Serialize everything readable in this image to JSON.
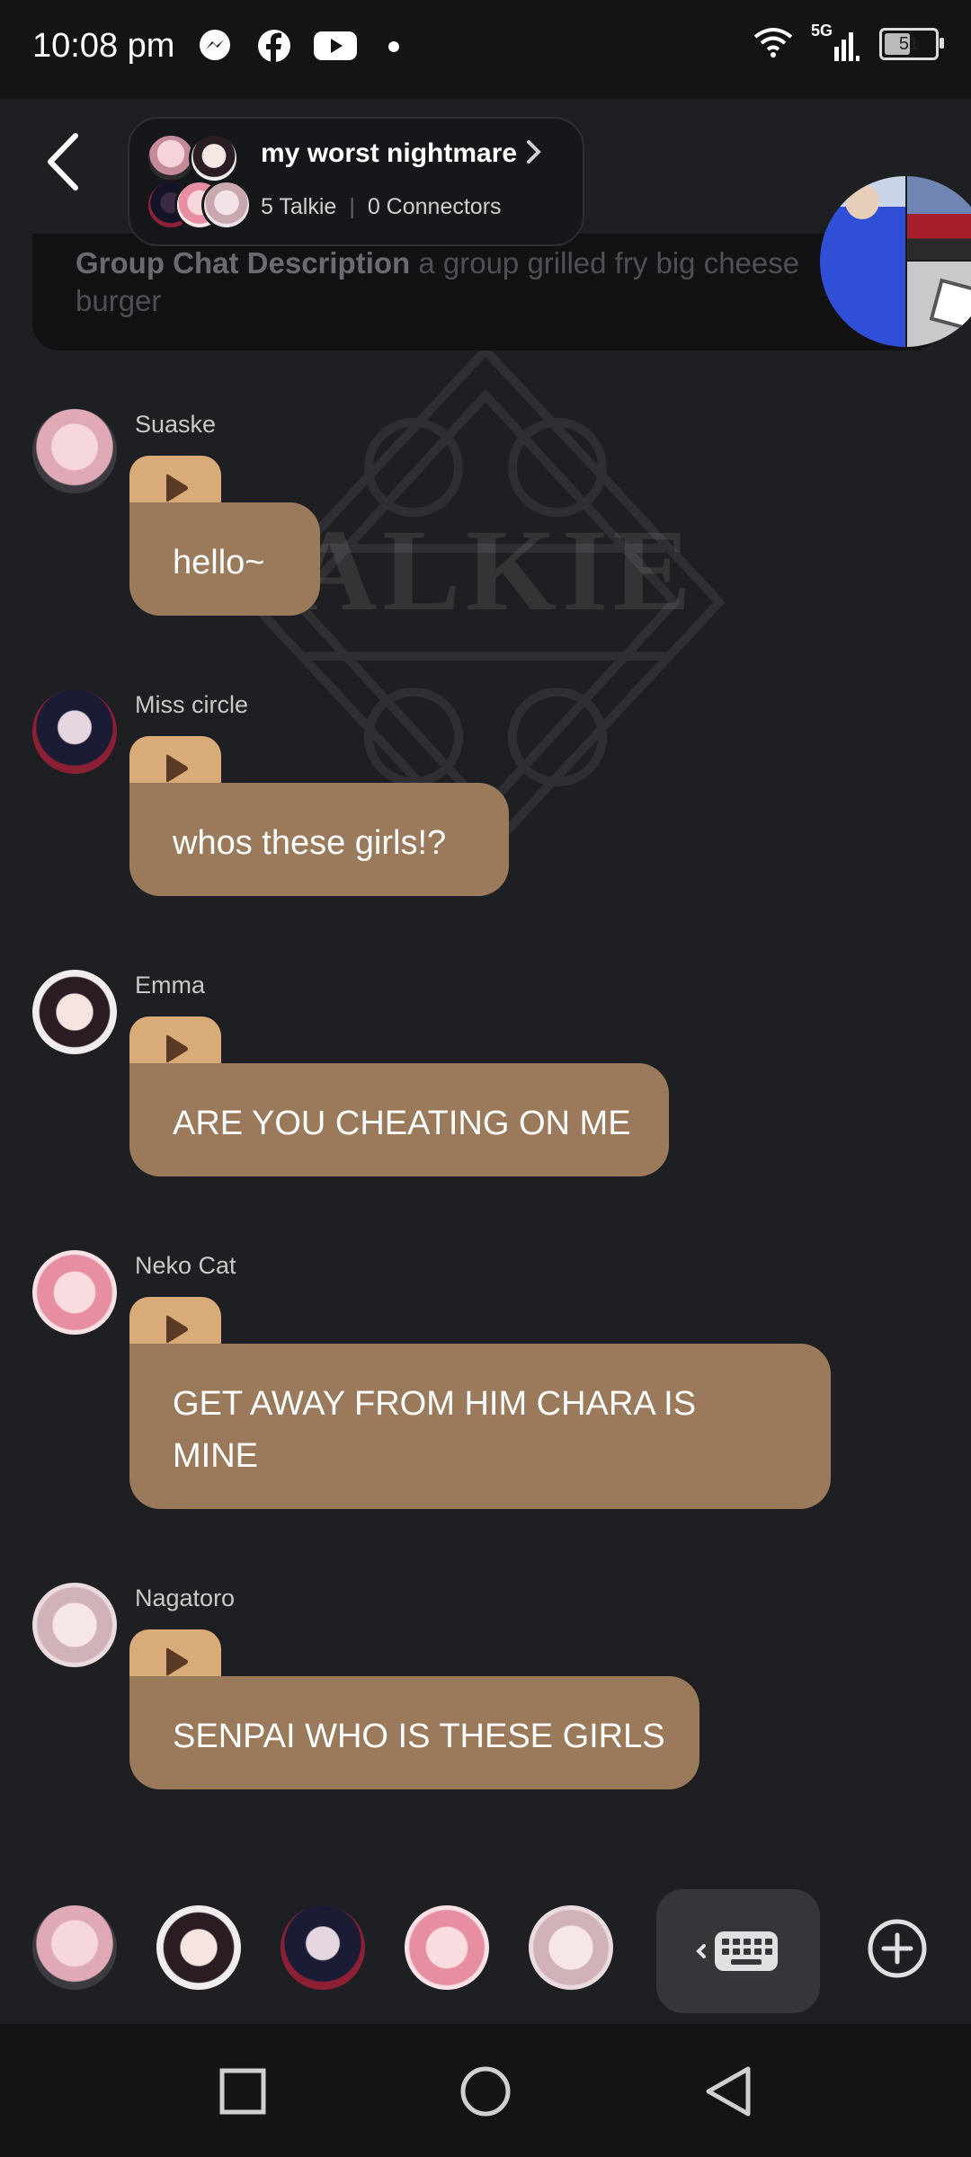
{
  "status_bar": {
    "time": "10:08 pm",
    "network": "5G",
    "battery": "51",
    "icons": [
      "messenger-icon",
      "facebook-icon",
      "youtube-icon",
      "notification-dot-icon",
      "wifi-icon",
      "signal-icon",
      "battery-icon"
    ]
  },
  "header": {
    "group_name": "my worst nightmare",
    "talkie_count": "5 Talkie",
    "connectors": "0 Connectors"
  },
  "description": {
    "label": "Group Chat Description",
    "text": "a group grilled fry big cheese burger"
  },
  "messages": [
    {
      "name": "Suaske",
      "text": "hello~",
      "avatar_color": "#e3b8c0"
    },
    {
      "name": "Miss circle",
      "text": "whos these girls!?",
      "avatar_color": "#1b1f3a"
    },
    {
      "name": "Emma",
      "text": "ARE YOU CHEATING ON ME",
      "avatar_color": "#f1e9e9"
    },
    {
      "name": "Neko Cat",
      "text": "GET AWAY FROM HIM CHARA IS MINE",
      "avatar_color": "#e9a2b2"
    },
    {
      "name": "Nagatoro",
      "text": "SENPAI WHO IS THESE GIRLS",
      "avatar_color": "#d9c0c6"
    }
  ],
  "colors": {
    "background": "#1e1f22",
    "bubble": "#9b7a5c",
    "play_tab": "#d8ab78",
    "play_icon": "#5a3a26"
  }
}
